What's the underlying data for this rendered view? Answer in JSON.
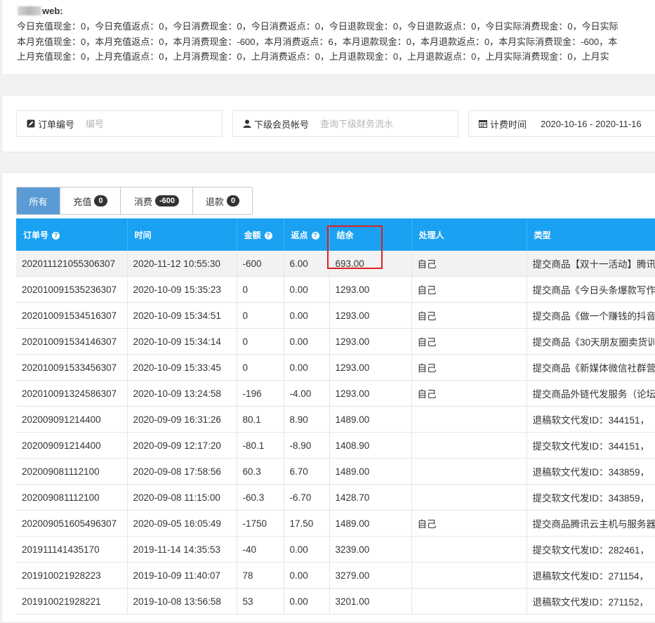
{
  "summary": {
    "title": "web:",
    "lines": [
      "今日充值现金：0，今日充值返点：0，今日消费现金：0，今日消费返点：0，今日退款现金：0，今日退款返点：0，今日实际消费现金：0，今日实际",
      "本月充值现金：0，本月充值返点：0，本月消费现金：-600，本月消费返点：6，本月退款现金：0，本月退款返点：0，本月实际消费现金：-600，本",
      "上月充值现金：0，上月充值返点：0，上月消费现金：0，上月消费返点：0，上月退款现金：0，上月退款返点：0，上月实际消费现金：0，上月实"
    ]
  },
  "filters": {
    "order": {
      "label": "订单编号",
      "placeholder": "编号",
      "icon": "edit-icon"
    },
    "member": {
      "label": "下级会员帐号",
      "placeholder": "查询下级财务流水",
      "icon": "user-icon"
    },
    "time": {
      "label": "计费时间",
      "value": "2020-10-16 - 2020-11-16",
      "icon": "calendar-icon"
    }
  },
  "tabs": [
    {
      "label": "所有",
      "badge": ""
    },
    {
      "label": "充值",
      "badge": "0"
    },
    {
      "label": "消费",
      "badge": "-600"
    },
    {
      "label": "退款",
      "badge": "0"
    }
  ],
  "table": {
    "headers": [
      "订单号",
      "时间",
      "金额",
      "返点",
      "结余",
      "处理人",
      "类型"
    ],
    "rows": [
      [
        "202011121055306307",
        "2020-11-12 10:55:30",
        "-600",
        "6.00",
        "693.00",
        "自己",
        "提交商品【双十一活动】腾讯"
      ],
      [
        "202010091535236307",
        "2020-10-09 15:35:23",
        "0",
        "0.00",
        "1293.00",
        "自己",
        "提交商品《今日头条爆款写作"
      ],
      [
        "202010091534516307",
        "2020-10-09 15:34:51",
        "0",
        "0.00",
        "1293.00",
        "自己",
        "提交商品《做一个赚钱的抖音"
      ],
      [
        "202010091534146307",
        "2020-10-09 15:34:14",
        "0",
        "0.00",
        "1293.00",
        "自己",
        "提交商品《30天朋友圈卖货训"
      ],
      [
        "202010091533456307",
        "2020-10-09 15:33:45",
        "0",
        "0.00",
        "1293.00",
        "自己",
        "提交商品《新媒体微信社群营"
      ],
      [
        "202010091324586307",
        "2020-10-09 13:24:58",
        "-196",
        "-4.00",
        "1293.00",
        "自己",
        "提交商品外链代发服务（论坛"
      ],
      [
        "202009091214400",
        "2020-09-09 16:31:26",
        "80.1",
        "8.90",
        "1489.00",
        "",
        "退稿软文代发ID：344151，"
      ],
      [
        "202009091214400",
        "2020-09-09 12:17:20",
        "-80.1",
        "-8.90",
        "1408.90",
        "",
        "提交软文代发ID：344151，"
      ],
      [
        "202009081112100",
        "2020-09-08 17:58:56",
        "60.3",
        "6.70",
        "1489.00",
        "",
        "退稿软文代发ID：343859，"
      ],
      [
        "202009081112100",
        "2020-09-08 11:15:00",
        "-60.3",
        "-6.70",
        "1428.70",
        "",
        "提交软文代发ID：343859，"
      ],
      [
        "202009051605496307",
        "2020-09-05 16:05:49",
        "-1750",
        "17.50",
        "1489.00",
        "自己",
        "提交商品腾讯云主机与服务器"
      ],
      [
        "201911141435170",
        "2019-11-14 14:35:53",
        "-40",
        "0.00",
        "3239.00",
        "",
        "提交软文代发ID：282461，"
      ],
      [
        "201910021928223",
        "2019-10-09 11:40:07",
        "78",
        "0.00",
        "3279.00",
        "",
        "退稿软文代发ID：271154，"
      ],
      [
        "201910021928221",
        "2019-10-08 13:56:58",
        "53",
        "0.00",
        "3201.00",
        "",
        "退稿软文代发ID：271152，"
      ]
    ]
  },
  "colors": {
    "header_bg": "#1aa1f2",
    "active_tab": "#5b9bd5",
    "highlight_box": "#e02020"
  }
}
